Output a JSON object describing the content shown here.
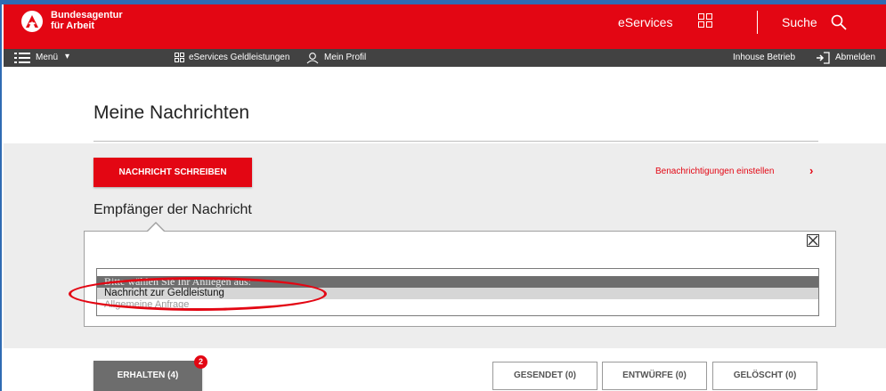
{
  "header": {
    "brand_line1": "Bundesagentur",
    "brand_line2": "für Arbeit",
    "eservices_label": "eServices",
    "search_label": "Suche"
  },
  "subnav": {
    "menu_label": "Menü",
    "eservices_link": "eServices Geldleistungen",
    "profile_link": "Mein Profil",
    "company_label": "Inhouse Betrieb",
    "logout_label": "Abmelden"
  },
  "main": {
    "page_title": "Meine Nachrichten",
    "write_button": "NACHRICHT SCHREIBEN",
    "notifications_link": "Benachrichtigungen einstellen",
    "recipient_label": "Empfänger der Nachricht"
  },
  "recipient_select": {
    "options": [
      "Bitte wählen Sie Ihr Anliegen aus:",
      "Nachricht zur Geldleistung",
      "Allgemeine Anfrage"
    ],
    "highlighted_index": 1
  },
  "tabs": {
    "received": "ERHALTEN (4)",
    "received_badge": "2",
    "sent": "GESENDET (0)",
    "drafts": "ENTWÜRFE (0)",
    "deleted": "GELÖSCHT (0)"
  },
  "colors": {
    "brand_red": "#e30613",
    "nav_dark": "#424242",
    "tab_active": "#6d6d6d",
    "annotation_circle": "#e30613"
  }
}
